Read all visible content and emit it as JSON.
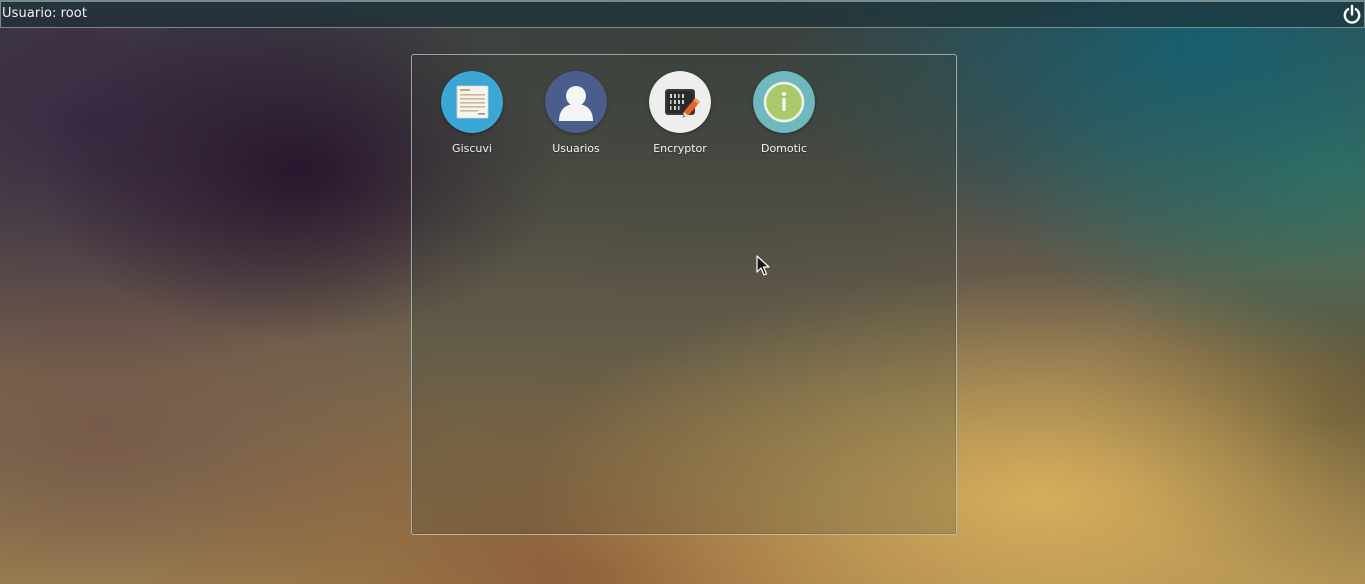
{
  "topbar": {
    "user_prefix": "Usuario:",
    "user_name": "root",
    "power_icon": "power-icon"
  },
  "launcher": {
    "apps": [
      {
        "label": "Giscuvi",
        "icon": "document-icon",
        "color": "#3ba8d8"
      },
      {
        "label": "Usuarios",
        "icon": "user-icon",
        "color": "#4a5e8c"
      },
      {
        "label": "Encryptor",
        "icon": "binary-edit-icon",
        "color": "#efefef"
      },
      {
        "label": "Domotic",
        "icon": "info-icon",
        "color": "#6fb8bf"
      }
    ]
  },
  "pointer": {
    "icon": "mouse-pointer-icon"
  }
}
